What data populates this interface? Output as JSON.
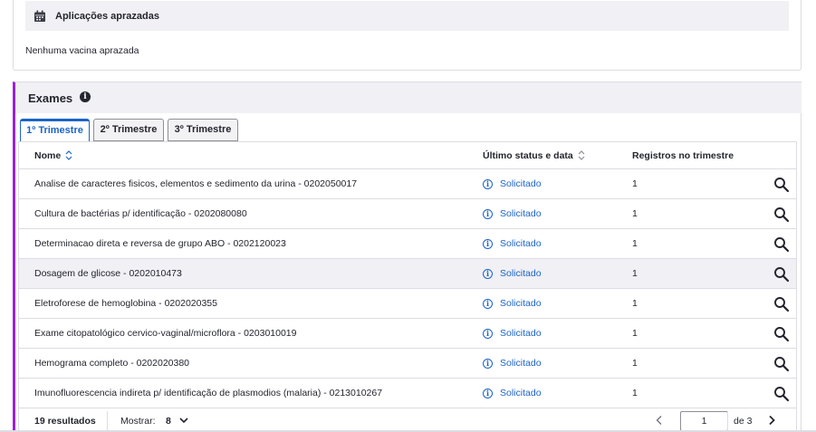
{
  "scheduled": {
    "title": "Aplicações aprazadas",
    "empty_message": "Nenhuma vacina aprazada"
  },
  "exams": {
    "title": "Exames",
    "info_icon": "info-icon",
    "accent_color": "#9b20d8",
    "tabs": [
      {
        "label": "1º Trimestre",
        "active": true
      },
      {
        "label": "2º Trimestre",
        "active": false
      },
      {
        "label": "3º Trimestre",
        "active": false
      }
    ],
    "columns": {
      "name": "Nome",
      "status": "Último status e data",
      "count": "Registros no trimestre"
    },
    "rows": [
      {
        "name": "Analise de caracteres fisicos, elementos e sedimento da urina - 0202050017",
        "status": "Solicitado",
        "count": "1"
      },
      {
        "name": "Cultura de bactérias p/ identificação - 0202080080",
        "status": "Solicitado",
        "count": "1"
      },
      {
        "name": "Determinacao direta e reversa de grupo ABO - 0202120023",
        "status": "Solicitado",
        "count": "1"
      },
      {
        "name": "Dosagem de glicose - 0202010473",
        "status": "Solicitado",
        "count": "1"
      },
      {
        "name": "Eletroforese de hemoglobina - 0202020355",
        "status": "Solicitado",
        "count": "1"
      },
      {
        "name": "Exame citopatológico cervico-vaginal/microflora - 0203010019",
        "status": "Solicitado",
        "count": "1"
      },
      {
        "name": "Hemograma completo - 0202020380",
        "status": "Solicitado",
        "count": "1"
      },
      {
        "name": "Imunofluorescencia indireta p/ identificação de plasmodios (malaria) - 0213010267",
        "status": "Solicitado",
        "count": "1"
      }
    ],
    "footer": {
      "results": "19 resultados",
      "show_label": "Mostrar:",
      "show_value": "8",
      "page": "1",
      "of_label": "de 3"
    }
  },
  "colors": {
    "link_blue": "#1c64c5",
    "header_bg": "#f0f0f5"
  }
}
